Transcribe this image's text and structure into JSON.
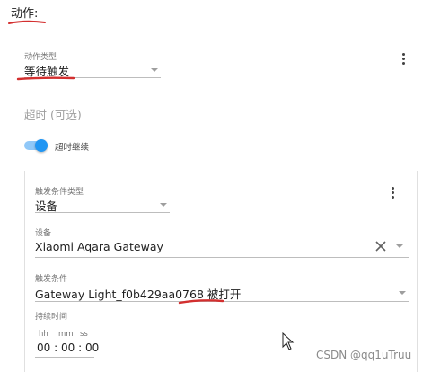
{
  "section": {
    "title": "动作:"
  },
  "action": {
    "type_label": "动作类型",
    "type_value": "等待触发",
    "timeout_placeholder": "超时 (可选)",
    "continue_toggle_label": "超时继续",
    "continue_toggle_on": true
  },
  "trigger": {
    "type_label": "触发条件类型",
    "type_value": "设备",
    "device_label": "设备",
    "device_value": "Xiaomi Aqara Gateway",
    "condition_label": "触发条件",
    "condition_value": "Gateway Light_f0b429aa0768 被打开",
    "duration_label": "持续时间",
    "duration_units": {
      "hh": "hh",
      "mm": "mm",
      "ss": "ss"
    },
    "duration_value": {
      "hh": "00",
      "mm": "00",
      "ss": "00"
    }
  },
  "watermark": "CSDN @qq1uTruu",
  "colors": {
    "accent": "#2196f3",
    "annotation": "#d32f2f"
  }
}
